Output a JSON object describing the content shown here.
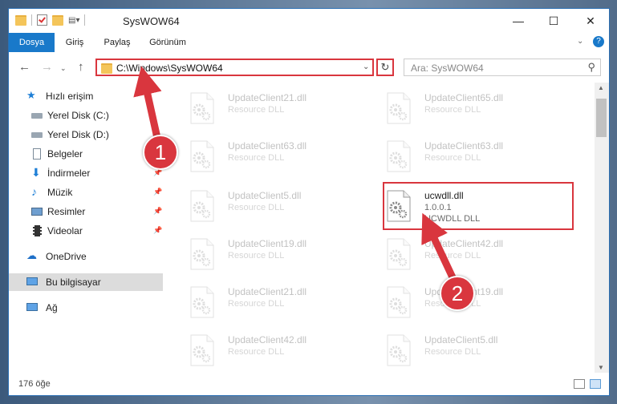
{
  "window": {
    "title": "SysWOW64",
    "controls": {
      "minimize": "—",
      "maximize": "☐",
      "close": "✕"
    }
  },
  "ribbon": {
    "tabs": [
      "Dosya",
      "Giriş",
      "Paylaş",
      "Görünüm"
    ],
    "active_tab": "Dosya"
  },
  "address": {
    "path": "C:\\Windows\\SysWOW64",
    "search_placeholder": "Ara: SysWOW64"
  },
  "sidebar": {
    "quick_access": "Hızlı erişim",
    "items": [
      {
        "label": "Yerel Disk (C:)",
        "icon": "drive-icon",
        "pinned": false
      },
      {
        "label": "Yerel Disk (D:)",
        "icon": "drive-icon",
        "pinned": false
      },
      {
        "label": "Belgeler",
        "icon": "documents-icon",
        "pinned": false
      },
      {
        "label": "İndirmeler",
        "icon": "download-icon",
        "pinned": true
      },
      {
        "label": "Müzik",
        "icon": "music-icon",
        "pinned": true
      },
      {
        "label": "Resimler",
        "icon": "pictures-icon",
        "pinned": true
      },
      {
        "label": "Videolar",
        "icon": "videos-icon",
        "pinned": true
      }
    ],
    "onedrive": "OneDrive",
    "this_pc": "Bu bilgisayar",
    "network": "Ağ"
  },
  "files": [
    {
      "name": "UpdateClient21.dll",
      "desc": "Resource DLL"
    },
    {
      "name": "UpdateClient65.dll",
      "desc": "Resource DLL"
    },
    {
      "name": "UpdateClient63.dll",
      "desc": "Resource DLL"
    },
    {
      "name": "UpdateClient63.dll",
      "desc": "Resource DLL"
    },
    {
      "name": "UpdateClient5.dll",
      "desc": "Resource DLL"
    },
    {
      "name": "UpdateClient19.dll",
      "desc": "Resource DLL"
    },
    {
      "name": "UpdateClient42.dll",
      "desc": "Resource DLL"
    },
    {
      "name": "UpdateClient21.dll",
      "desc": "Resource DLL"
    },
    {
      "name": "UpdateClient19.dll",
      "desc": "Resource DLL"
    },
    {
      "name": "UpdateClient42.dll",
      "desc": "Resource DLL"
    },
    {
      "name": "UpdateClient5.dll",
      "desc": "Resource DLL"
    }
  ],
  "highlighted_file": {
    "name": "ucwdll.dll",
    "version": "1.0.0.1",
    "desc": "UCWDLL DLL"
  },
  "status": {
    "count": "176 öğe"
  },
  "annotations": {
    "step1": "1",
    "step2": "2"
  },
  "colors": {
    "accent": "#1979ca",
    "highlight": "#d9363e"
  }
}
